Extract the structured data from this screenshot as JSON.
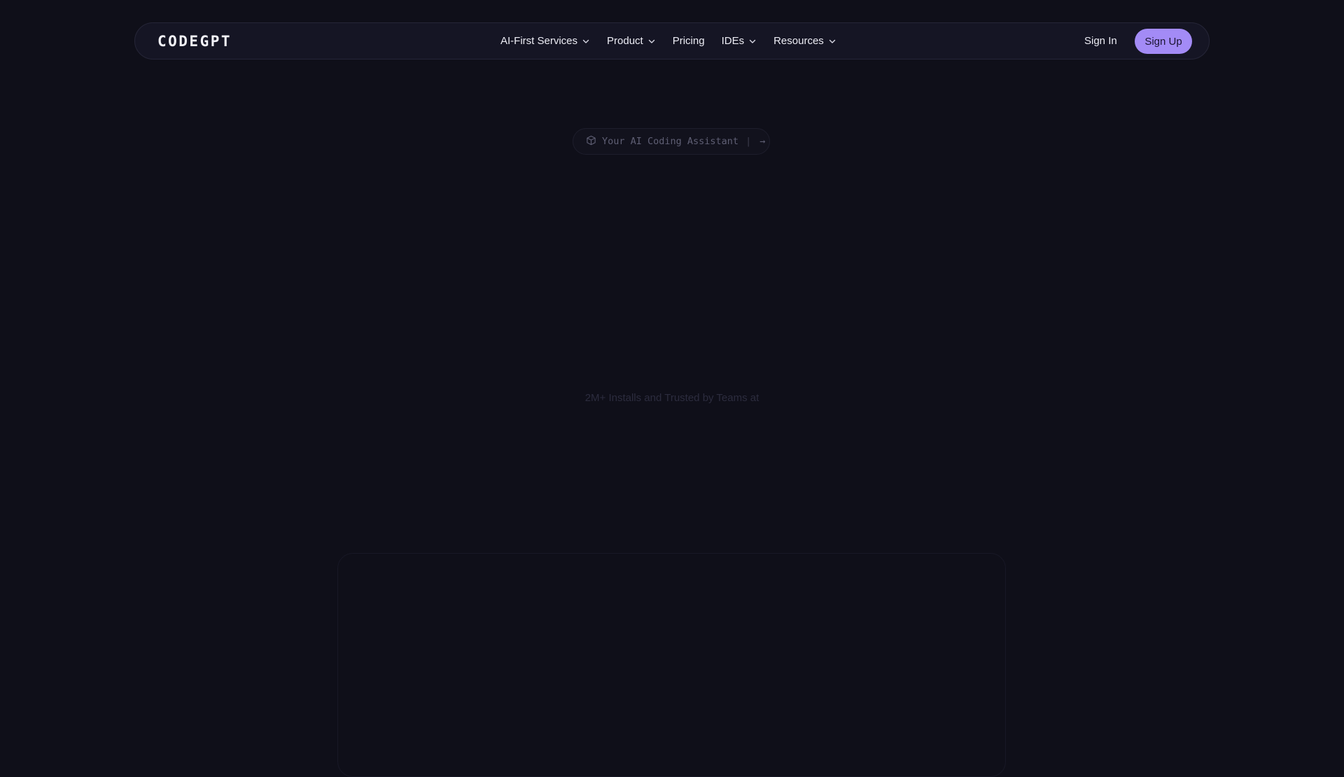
{
  "header": {
    "logo": "CODEGPT",
    "nav": [
      {
        "label": "AI-First Services",
        "has_dropdown": true
      },
      {
        "label": "Product",
        "has_dropdown": true
      },
      {
        "label": "Pricing",
        "has_dropdown": false
      },
      {
        "label": "IDEs",
        "has_dropdown": true
      },
      {
        "label": "Resources",
        "has_dropdown": true
      }
    ],
    "sign_in": "Sign In",
    "sign_up": "Sign Up"
  },
  "hero": {
    "badge_text": "Your AI Coding Assistant",
    "badge_separator": "|",
    "badge_arrow": "→",
    "badge_icon": "cube-icon"
  },
  "trusted_text": "2M+ Installs and Trusted by Teams at",
  "colors": {
    "background": "#0f0f19",
    "navbar": "#151524",
    "accent": "#a38bf6"
  }
}
